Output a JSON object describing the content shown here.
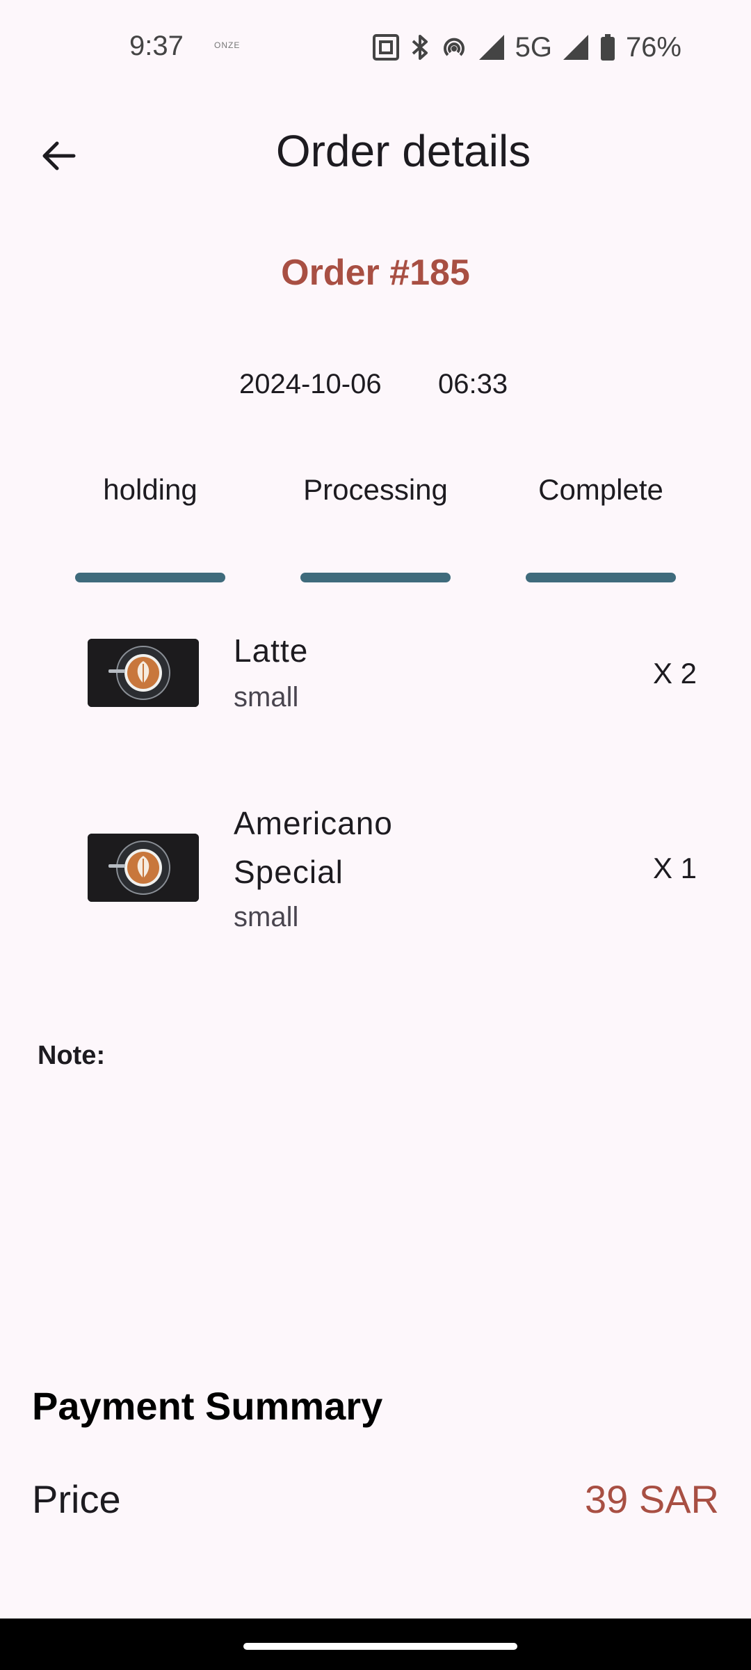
{
  "status_bar": {
    "time": "9:37",
    "tiny_text": "ONZE",
    "network": "5G",
    "battery": "76%"
  },
  "header": {
    "title": "Order details",
    "back_icon": "arrow-back-icon"
  },
  "order": {
    "number": "Order #185",
    "date": "2024-10-06",
    "time": "06:33"
  },
  "steps": [
    {
      "label": "holding"
    },
    {
      "label": "Processing"
    },
    {
      "label": "Complete"
    }
  ],
  "items": [
    {
      "name": "Latte",
      "size": "small",
      "qty": "X 2",
      "thumb_icon": "latte-art-image"
    },
    {
      "name_line1": "Americano",
      "name_line2": "Special",
      "size": "small",
      "qty": "X 1",
      "thumb_icon": "latte-art-image"
    }
  ],
  "note": {
    "label": "Note:"
  },
  "payment": {
    "title": "Payment Summary",
    "price_label": "Price",
    "price_value": "39 SAR"
  },
  "colors": {
    "accent": "#a84f43",
    "step_bar": "#3f6b7c",
    "background": "#fdf7fb"
  }
}
